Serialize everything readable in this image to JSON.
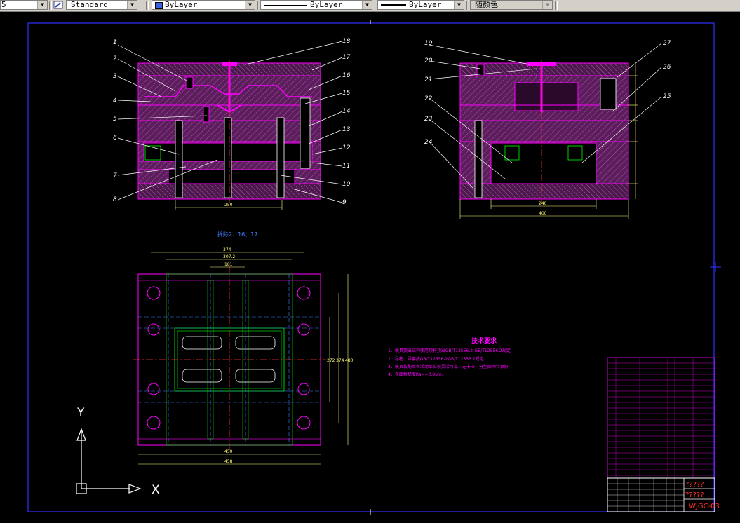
{
  "toolbar": {
    "partial_left": "5",
    "text_style": "Standard",
    "layer": "ByLayer",
    "linetype": "ByLayer",
    "lineweight": "ByLayer",
    "plot_style": "随颜色"
  },
  "drawing": {
    "front_view": {
      "balloons": [
        "1",
        "2",
        "3",
        "4",
        "5",
        "6",
        "7",
        "8",
        "18",
        "17",
        "16",
        "15",
        "14",
        "13",
        "12",
        "11",
        "10",
        "9"
      ],
      "dim_width": "250"
    },
    "side_view": {
      "balloons": [
        "19",
        "20",
        "21",
        "22",
        "23",
        "24",
        "27",
        "26",
        "25"
      ],
      "dim_inner": "240",
      "dim_outer": "400"
    },
    "plan_view": {
      "title": "拆除2、16、17",
      "dims_top": [
        "374",
        "307.2",
        "181"
      ],
      "dims_bottom": [
        "450",
        "458"
      ],
      "dims_right": [
        "272",
        "374",
        "480"
      ]
    },
    "tech_requirements": {
      "title": "技术要求",
      "lines": [
        "1、模具顶出结构使用顶杆顶出GB/T12556.2-GB/T12556.2规定",
        "2、导柱、导套按GB/T12556-2GB/T12556.2规定",
        "3、模具装配后各活动部位须灵活可靠、无卡滞，分型面吻合良好",
        "4、表面粗糙度Ra<=0.8um。"
      ]
    },
    "title_block": {
      "title_marks_1": "?????",
      "title_marks_2": "?????",
      "drawing_no": "WJGC-03"
    },
    "ucs": {
      "x_label": "X",
      "y_label": "Y"
    }
  },
  "colors": {
    "background": "#000000",
    "border": "#3030ff",
    "part": "#ff00ff",
    "leader": "#ffffff",
    "dimension": "#ffff80",
    "centerline": "#ff3030",
    "green_line": "#00ff00",
    "table": "#c000c0"
  }
}
